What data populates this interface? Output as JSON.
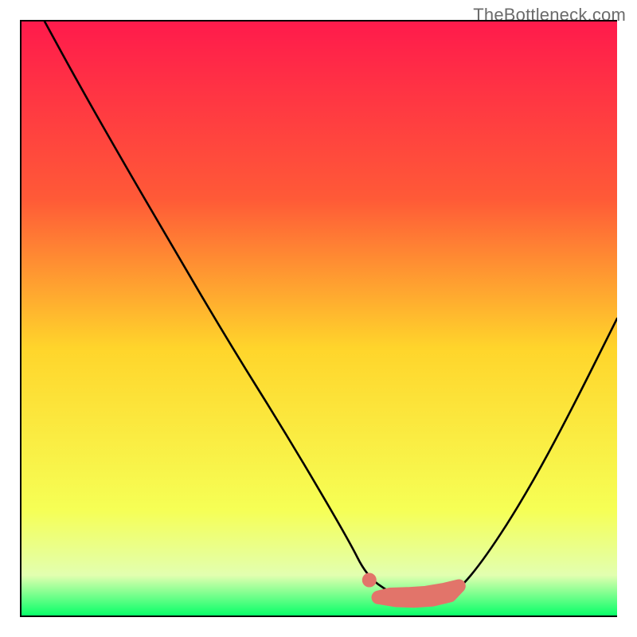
{
  "watermark": "TheBottleneck.com",
  "colors": {
    "gradient_top": "#ff1a4c",
    "gradient_upper": "#ff5a37",
    "gradient_mid": "#ffd52b",
    "gradient_lower": "#f6ff55",
    "gradient_band": "#e2ffb0",
    "gradient_bottom": "#00ff66",
    "curve": "#000000",
    "marker": "#e2746a",
    "frame": "#000000"
  },
  "chart_data": {
    "type": "line",
    "title": "",
    "xlabel": "",
    "ylabel": "",
    "xlim": [
      0,
      100
    ],
    "ylim": [
      0,
      100
    ],
    "series": [
      {
        "name": "bottleneck-curve",
        "x": [
          4,
          10,
          18,
          25,
          35,
          45,
          55,
          58,
          62,
          66,
          70,
          73,
          78,
          85,
          92,
          100
        ],
        "y": [
          100,
          89,
          75,
          63,
          46,
          30,
          13,
          7,
          4,
          3,
          3,
          4,
          10,
          21,
          34,
          50
        ]
      }
    ],
    "markers": [
      {
        "name": "valley-highlight-left-dot",
        "x": 58.5,
        "y": 6.2
      },
      {
        "name": "valley-highlight-band",
        "path_x": [
          60,
          63,
          66,
          69,
          72,
          73.5,
          71,
          68,
          65,
          62,
          60
        ],
        "path_y": [
          3.3,
          2.8,
          2.7,
          2.9,
          3.6,
          5.2,
          4.6,
          4.1,
          3.9,
          3.8,
          3.3
        ]
      }
    ],
    "background": {
      "type": "vertical-gradient",
      "stops": [
        {
          "pos": 0.0,
          "key": "gradient_top"
        },
        {
          "pos": 0.3,
          "key": "gradient_upper"
        },
        {
          "pos": 0.55,
          "key": "gradient_mid"
        },
        {
          "pos": 0.82,
          "key": "gradient_lower"
        },
        {
          "pos": 0.93,
          "key": "gradient_band"
        },
        {
          "pos": 1.0,
          "key": "gradient_bottom"
        }
      ]
    }
  }
}
